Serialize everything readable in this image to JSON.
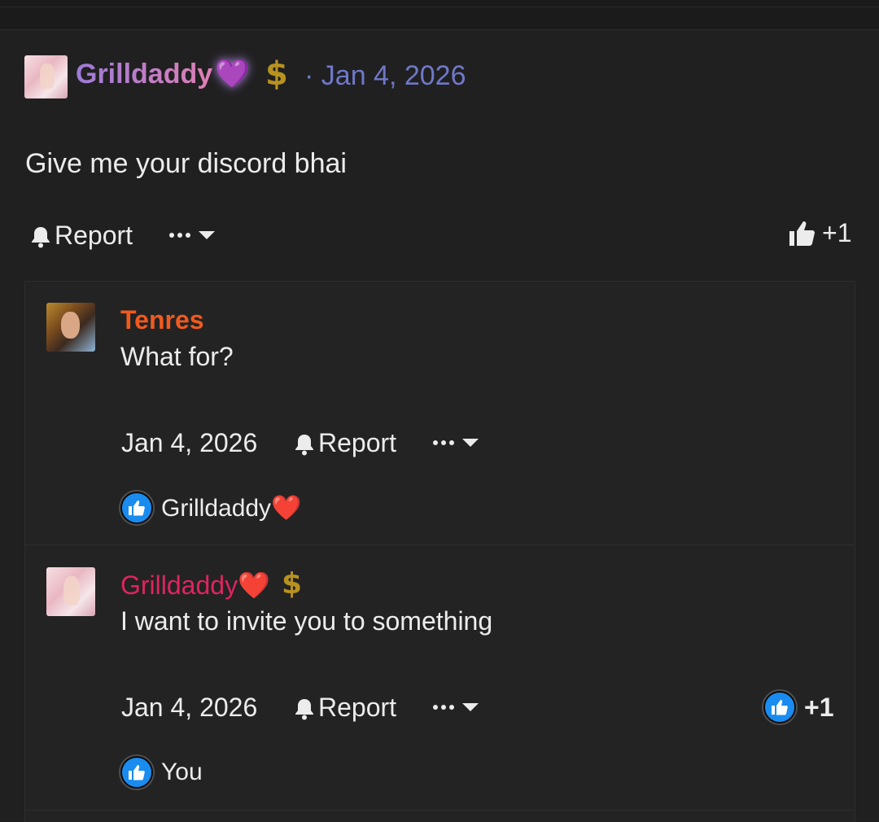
{
  "post": {
    "author": "Grilldaddy",
    "author_heart": "💜",
    "badge": "$",
    "separator": "·",
    "date": "Jan 4, 2026",
    "message": "Give me your discord bhai",
    "report_label": "Report",
    "like_count": "+1"
  },
  "replies": [
    {
      "author": "Tenres",
      "message": "What for?",
      "date": "Jan 4, 2026",
      "report_label": "Report",
      "reactor": "Grilldaddy",
      "reactor_heart": "❤️"
    },
    {
      "author": "Grilldaddy",
      "author_heart": "❤️",
      "badge": "$",
      "message": "I want to invite you to something",
      "date": "Jan 4, 2026",
      "report_label": "Report",
      "like_count": "+1",
      "reactor": "You"
    }
  ],
  "colors": {
    "background": "#202021",
    "tenres_name": "#f05a1e",
    "grilldaddy_name": "#e0245e",
    "date_link": "#6f78c8",
    "like_blue": "#1a8cf0",
    "badge_gold": "#b8921f"
  },
  "icons": [
    "bell-icon",
    "more-dots-icon",
    "caret-down-icon",
    "thumbs-up-icon",
    "like-reaction-icon",
    "dollar-badge-icon",
    "heart-icon"
  ]
}
